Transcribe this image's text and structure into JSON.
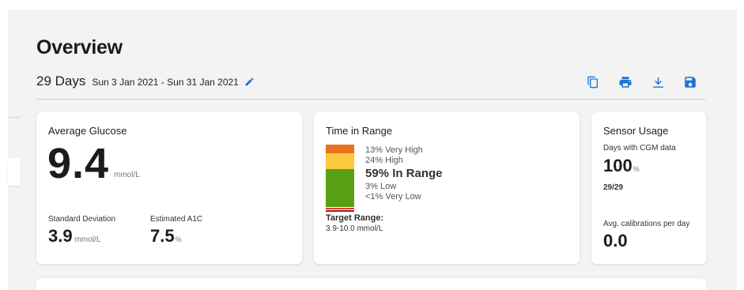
{
  "overview": {
    "title": "Overview",
    "days": "29 Days",
    "date_range": "Sun 3 Jan 2021 - Sun 31 Jan 2021"
  },
  "toolbar": {
    "icons": [
      "copy-icon",
      "print-icon",
      "download-icon",
      "save-icon"
    ],
    "accent": "#1976d2"
  },
  "average_glucose": {
    "title": "Average Glucose",
    "value": "9.4",
    "unit": "mmol/L",
    "std_dev_label": "Standard Deviation",
    "std_dev_value": "3.9",
    "std_dev_unit": "mmol/L",
    "a1c_label": "Estimated A1C",
    "a1c_value": "7.5",
    "a1c_unit": "%"
  },
  "time_in_range": {
    "title": "Time in Range",
    "very_high": "13% Very High",
    "high": "24% High",
    "in_range": "59% In Range",
    "low": "3% Low",
    "very_low": "<1% Very Low",
    "percentages": {
      "very_high": 13,
      "high": 24,
      "in_range": 59,
      "low": 3,
      "very_low": 1
    },
    "colors": {
      "very_high": "#e8711a",
      "high": "#fbc93d",
      "in_range": "#5aa017",
      "low": "#e53935",
      "very_low": "#a31515"
    },
    "target_label": "Target Range:",
    "target_value": "3.9-10.0 mmol/L"
  },
  "sensor_usage": {
    "title": "Sensor Usage",
    "days_label": "Days with CGM data",
    "days_pct": "100",
    "days_pct_unit": "%",
    "days_count": "29/29",
    "calib_label": "Avg. calibrations per day",
    "calib_value": "0.0"
  }
}
